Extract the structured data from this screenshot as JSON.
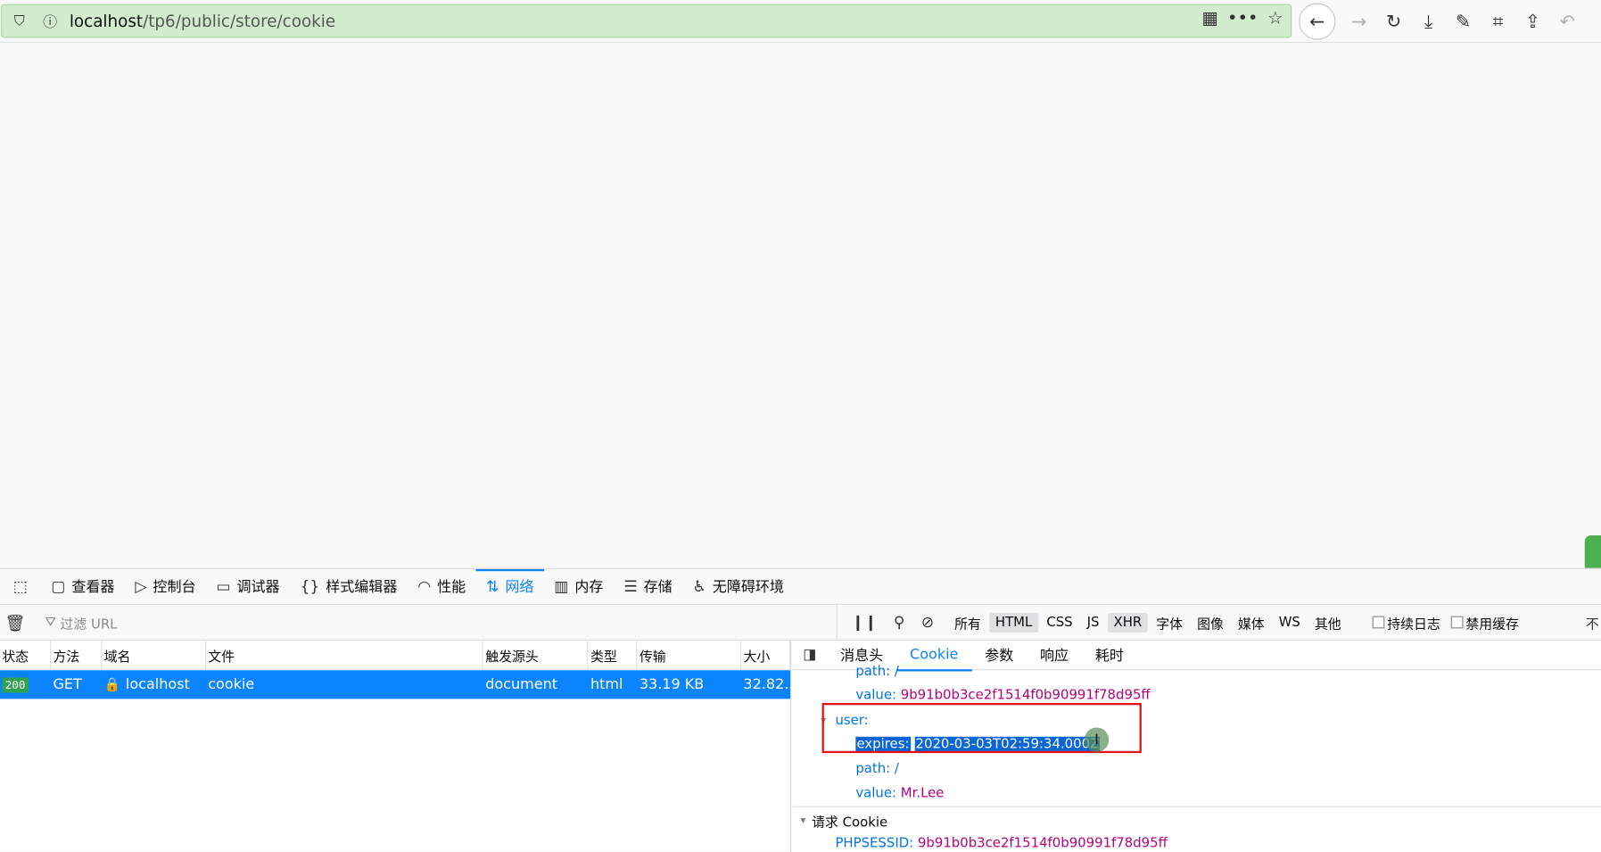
{
  "browser": {
    "url_host": "localhost",
    "url_path": "/tp6/public/store/cookie"
  },
  "devtools": {
    "tabs": [
      {
        "label": "查看器",
        "icon": "inspector-icon"
      },
      {
        "label": "控制台",
        "icon": "console-icon"
      },
      {
        "label": "调试器",
        "icon": "debugger-icon"
      },
      {
        "label": "样式编辑器",
        "icon": "style-editor-icon"
      },
      {
        "label": "性能",
        "icon": "performance-icon"
      },
      {
        "label": "网络",
        "icon": "network-icon"
      },
      {
        "label": "内存",
        "icon": "memory-icon"
      },
      {
        "label": "存储",
        "icon": "storage-icon"
      },
      {
        "label": "无障碍环境",
        "icon": "accessibility-icon"
      }
    ],
    "active_tab": "网络",
    "filter_placeholder": "过滤 URL",
    "type_filters": [
      "所有",
      "HTML",
      "CSS",
      "JS",
      "XHR",
      "字体",
      "图像",
      "媒体",
      "WS",
      "其他"
    ],
    "selected_types": [
      "HTML",
      "XHR"
    ],
    "persist_log": "持续日志",
    "disable_cache": "禁用缓存",
    "more": "不"
  },
  "requests": {
    "columns": [
      "状态",
      "方法",
      "域名",
      "文件",
      "触发源头",
      "类型",
      "传输",
      "大小"
    ],
    "rows": [
      {
        "status": "200",
        "method": "GET",
        "domain": "localhost",
        "file": "cookie",
        "cause": "document",
        "type": "html",
        "transferred": "33.19 KB",
        "size": "32.82..."
      }
    ]
  },
  "details": {
    "tabs": [
      "消息头",
      "Cookie",
      "参数",
      "响应",
      "耗时"
    ],
    "active_tab": "Cookie",
    "cookies": {
      "path_top": "path: /",
      "value_top_key": "value:",
      "value_top": "9b91b0b3ce2f1514f0b90991f78d95ff",
      "user_label": "user:",
      "expires_key": "expires:",
      "expires": "2020-03-03T02:59:34.000Z",
      "path_user": "path: /",
      "value_user_key": "value:",
      "value_user": "Mr.Lee"
    },
    "request_cookie_section": "请求 Cookie",
    "phpsessid_key": "PHPSESSID:",
    "phpsessid": "9b91b0b3ce2f1514f0b90991f78d95ff"
  },
  "colors": {
    "accent": "#0a84ff",
    "url_bg": "#d1edcd",
    "status_ok": "#30a14e",
    "highlight_box": "#e51515",
    "value_color": "#b5007f"
  }
}
